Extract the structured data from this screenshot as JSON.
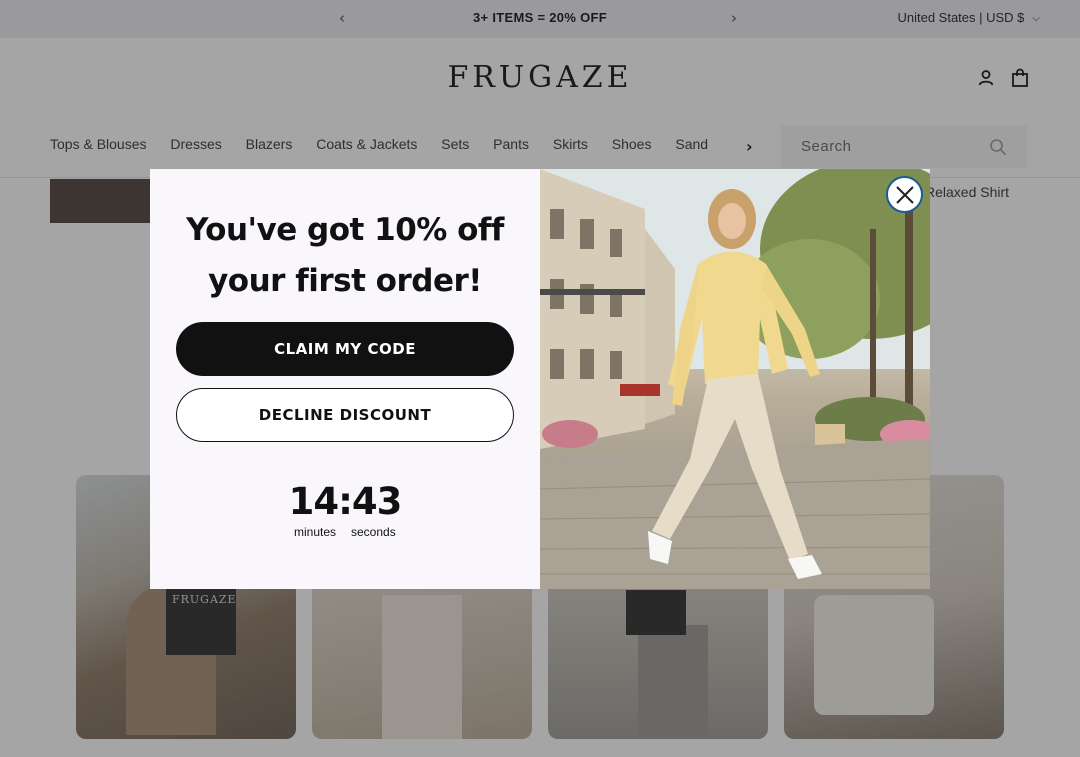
{
  "announcement": {
    "promo": "3+ ITEMS = 20% OFF",
    "locale": "United States | USD $",
    "prev_icon": "chevron-left-icon",
    "next_icon": "chevron-right-icon"
  },
  "header": {
    "logo": "FRUGAZE",
    "nav": [
      "Tops & Blouses",
      "Dresses",
      "Blazers",
      "Coats & Jackets",
      "Sets",
      "Pants",
      "Skirts",
      "Shoes",
      "Sand"
    ],
    "nav_more": "›",
    "search_placeholder": "Search"
  },
  "page": {
    "product_title_fragment": "Relaxed Shirt",
    "ugc_book_text": "FRUGAZE"
  },
  "popup": {
    "headline_line1": "You've got 10% off",
    "headline_line2": "your first order!",
    "claim_label": "CLAIM MY CODE",
    "decline_label": "DECLINE DISCOUNT",
    "timer": "14:43",
    "timer_minutes_label": "minutes",
    "timer_seconds_label": "seconds",
    "close_icon": "close-icon"
  },
  "colors": {
    "overlay": "#000000",
    "modal_bg": "#faf7fc",
    "primary_button": "#111111",
    "close_ring": "#1a5a99"
  }
}
